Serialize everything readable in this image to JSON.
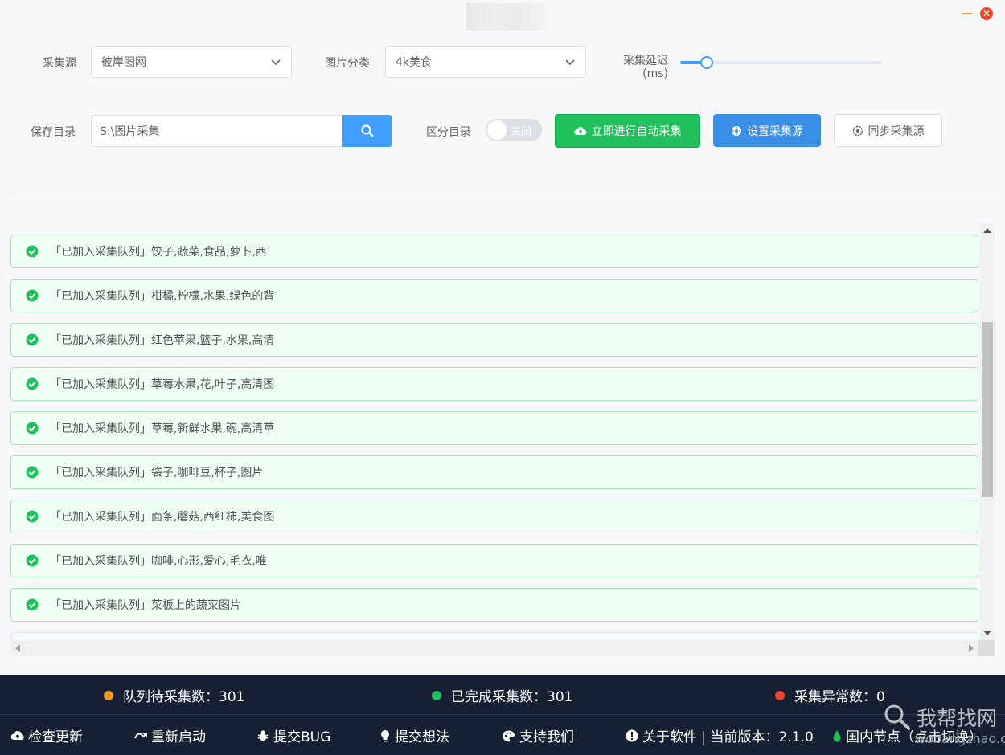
{
  "window": {
    "min_label": "",
    "close_label": "✕"
  },
  "form": {
    "source_label": "采集源",
    "source_value": "彼岸图网",
    "category_label": "图片分类",
    "category_value": "4k美食",
    "delay_label_line1": "采集延迟",
    "delay_label_line2": "(ms)",
    "delay_level": 0.13,
    "save_dir_label": "保存目录",
    "save_dir_value": "S:\\图片采集",
    "split_dir_label": "区分目录",
    "split_dir_toggle": "关闭"
  },
  "buttons": {
    "auto_collect": "立即进行自动采集",
    "set_source": "设置采集源",
    "sync_source": "同步采集源"
  },
  "log": [
    "「已加入采集队列」饺子,蔬菜,食品,萝卜,西",
    "「已加入采集队列」柑橘,柠檬,水果,绿色的背",
    "「已加入采集队列」红色苹果,篮子,水果,高清",
    "「已加入采集队列」草莓水果,花,叶子,高清图",
    "「已加入采集队列」草莓,新鲜水果,碗,高清草",
    "「已加入采集队列」袋子,咖啡豆,杯子,图片",
    "「已加入采集队列」面条,蘑菇,西红柿,美食图",
    "「已加入采集队列」咖啡,心形,爱心,毛衣,唯",
    "「已加入采集队列」菜板上的蔬菜图片"
  ],
  "stats": {
    "pending_label": "队列待采集数：301",
    "done_label": "已完成采集数：301",
    "error_label": "采集异常数：0"
  },
  "footer_links": {
    "check_update": "检查更新",
    "restart": "重新启动",
    "submit_bug": "提交BUG",
    "submit_idea": "提交想法",
    "support_us": "支持我们",
    "about": "关于软件 | 当前版本：2.1.0",
    "node": "国内节点（点击切换）"
  },
  "watermark": {
    "text": "我帮找网",
    "url": "wobangzhao.com"
  },
  "colors": {
    "accent_blue": "#409eff",
    "success_green": "#20c05c",
    "footer_bg": "#172033",
    "pending_dot": "#f59a23",
    "done_dot": "#20c05c",
    "error_dot": "#e8472d"
  }
}
